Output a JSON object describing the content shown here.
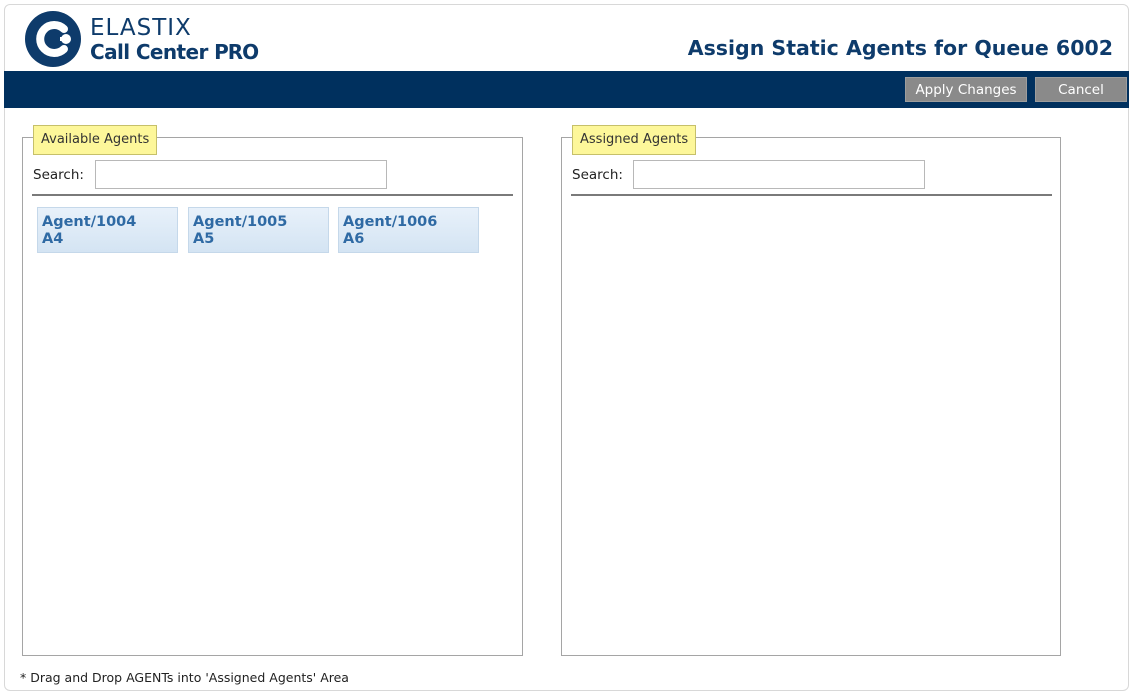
{
  "logo": {
    "top_text": "ELASTIX",
    "bottom_text_regular": "Call Center ",
    "bottom_text_bold": "PRO",
    "color": "#0e3b6b"
  },
  "page_title": "Assign Static Agents for Queue 6002",
  "toolbar": {
    "apply_label": "Apply Changes",
    "cancel_label": "Cancel",
    "bar_color": "#00305e"
  },
  "available": {
    "legend": "Available Agents",
    "search_label": "Search:",
    "search_value": "",
    "agents": [
      {
        "id": "Agent/1004",
        "name": "A4"
      },
      {
        "id": "Agent/1005",
        "name": "A5"
      },
      {
        "id": "Agent/1006",
        "name": "A6"
      }
    ]
  },
  "assigned": {
    "legend": "Assigned Agents",
    "search_label": "Search:",
    "search_value": "",
    "agents": []
  },
  "footnote": "* Drag and Drop AGENTs into 'Assigned Agents' Area"
}
